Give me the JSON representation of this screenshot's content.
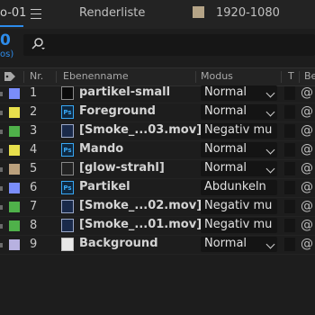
{
  "tabs": {
    "comp_label": "o-01",
    "render_label": "Renderliste",
    "resolution": "1920-1080",
    "resolution_color": "#b5a487"
  },
  "time": {
    "timecode": "0",
    "fps": "os)"
  },
  "search": {
    "icon": "search-icon"
  },
  "columns": {
    "num": "Nr.",
    "name": "Ebenenname",
    "mode": "Modus",
    "t": "T",
    "parent": "Bene"
  },
  "layers": [
    {
      "num": "1",
      "name": "partikel-small",
      "mode": "Normal",
      "label_color": "#7a8dfa",
      "icon": "solid-icon"
    },
    {
      "num": "2",
      "name": "Foreground",
      "mode": "Normal",
      "label_color": "#e8e04c",
      "icon": "photoshop-icon"
    },
    {
      "num": "3",
      "name": "[Smoke_...03.mov]",
      "mode": "Negativ mu",
      "label_color": "#4fb14a",
      "icon": "footage-icon"
    },
    {
      "num": "4",
      "name": "Mando",
      "mode": "Normal",
      "label_color": "#e8e04c",
      "icon": "photoshop-icon"
    },
    {
      "num": "5",
      "name": "[glow-strahl]",
      "mode": "Normal",
      "label_color": "#bba07c",
      "icon": "composition-icon"
    },
    {
      "num": "6",
      "name": "Partikel",
      "mode": "Abdunkeln",
      "label_color": "#7a8dfa",
      "icon": "photoshop-icon"
    },
    {
      "num": "7",
      "name": "[Smoke_...02.mov]",
      "mode": "Negativ mu",
      "label_color": "#4fb14a",
      "icon": "footage-icon"
    },
    {
      "num": "8",
      "name": "[Smoke_...01.mov]",
      "mode": "Negativ mu",
      "label_color": "#4fb14a",
      "icon": "footage-icon"
    },
    {
      "num": "9",
      "name": "Background",
      "mode": "Normal",
      "label_color": "#b7b1e0",
      "icon": "document-icon"
    }
  ],
  "parent_glyph": "@",
  "accent": "#2d8ceb"
}
